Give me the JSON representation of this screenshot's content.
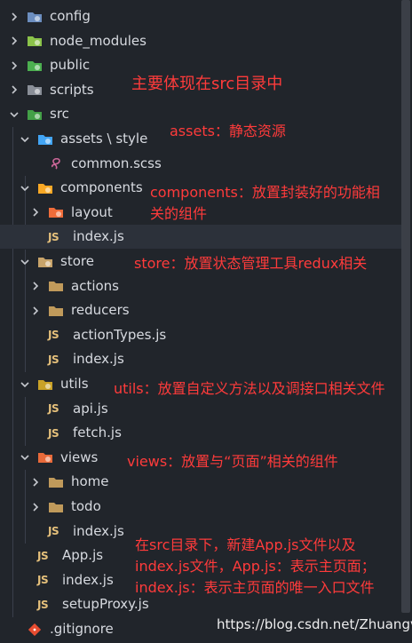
{
  "explorer": {
    "items": [
      {
        "label": "config",
        "depth": 0,
        "type": "folder",
        "expanded": false,
        "icon": "folder-config-icon"
      },
      {
        "label": "node_modules",
        "depth": 0,
        "type": "folder",
        "expanded": false,
        "icon": "folder-node-icon"
      },
      {
        "label": "public",
        "depth": 0,
        "type": "folder",
        "expanded": false,
        "icon": "folder-public-icon"
      },
      {
        "label": "scripts",
        "depth": 0,
        "type": "folder",
        "expanded": false,
        "icon": "folder-scripts-icon"
      },
      {
        "label": "src",
        "depth": 0,
        "type": "folder",
        "expanded": true,
        "icon": "folder-src-icon"
      },
      {
        "label": "assets \\ style",
        "depth": 1,
        "type": "folder",
        "expanded": true,
        "icon": "folder-assets-icon"
      },
      {
        "label": "common.scss",
        "depth": 2,
        "type": "scss",
        "icon": "sass-file-icon"
      },
      {
        "label": "components",
        "depth": 1,
        "type": "folder",
        "expanded": true,
        "icon": "folder-components-icon"
      },
      {
        "label": "layout",
        "depth": 2,
        "type": "folder",
        "expanded": false,
        "icon": "folder-layout-icon"
      },
      {
        "label": "index.js",
        "depth": 2,
        "type": "js",
        "selected": true,
        "icon": "js-file-icon"
      },
      {
        "label": "store",
        "depth": 1,
        "type": "folder",
        "expanded": true,
        "icon": "folder-store-icon"
      },
      {
        "label": "actions",
        "depth": 2,
        "type": "folder",
        "expanded": false,
        "icon": "folder-icon"
      },
      {
        "label": "reducers",
        "depth": 2,
        "type": "folder",
        "expanded": false,
        "icon": "folder-icon"
      },
      {
        "label": "actionTypes.js",
        "depth": 2,
        "type": "js",
        "icon": "js-file-icon"
      },
      {
        "label": "index.js",
        "depth": 2,
        "type": "js",
        "icon": "js-file-icon"
      },
      {
        "label": "utils",
        "depth": 1,
        "type": "folder",
        "expanded": true,
        "icon": "folder-utils-icon"
      },
      {
        "label": "api.js",
        "depth": 2,
        "type": "js",
        "icon": "js-file-icon"
      },
      {
        "label": "fetch.js",
        "depth": 2,
        "type": "js",
        "icon": "js-file-icon"
      },
      {
        "label": "views",
        "depth": 1,
        "type": "folder",
        "expanded": true,
        "icon": "folder-views-icon"
      },
      {
        "label": "home",
        "depth": 2,
        "type": "folder",
        "expanded": false,
        "icon": "folder-icon"
      },
      {
        "label": "todo",
        "depth": 2,
        "type": "folder",
        "expanded": false,
        "icon": "folder-icon"
      },
      {
        "label": "index.js",
        "depth": 2,
        "type": "js",
        "icon": "js-file-icon"
      },
      {
        "label": "App.js",
        "depth": 1,
        "type": "js",
        "icon": "js-file-icon"
      },
      {
        "label": "index.js",
        "depth": 1,
        "type": "js",
        "icon": "js-file-icon"
      },
      {
        "label": "setupProxy.js",
        "depth": 1,
        "type": "js",
        "icon": "js-file-icon"
      },
      {
        "label": ".gitignore",
        "depth": 0,
        "type": "git",
        "icon": "git-file-icon"
      }
    ],
    "js_badge": "JS"
  },
  "annotations": {
    "src_note": "主要体现在src目录中",
    "assets_note": "assets：静态资源",
    "components_note_line1": "components：放置封装好的功能相",
    "components_note_line2": "关的组件",
    "store_note": "store：放置状态管理工具redux相关",
    "utils_note": "utils：放置自定义方法以及调接口相关文件",
    "views_note": "views：放置与“页面”相关的组件",
    "bottom_note_line1": "在src目录下，新建App.js文件以及",
    "bottom_note_line2": "index.js文件，App.js：表示主页面；",
    "bottom_note_line3": "index.js：表示主页面的唯一入口文件"
  },
  "watermark": "https://blog.csdn.net/Zhuangvi",
  "colors": {
    "background": "#21252b",
    "selected_row": "#2c313a",
    "text": "#d7dae0",
    "annotation": "#ff3b3b",
    "js_badge": "#e5c07b"
  }
}
